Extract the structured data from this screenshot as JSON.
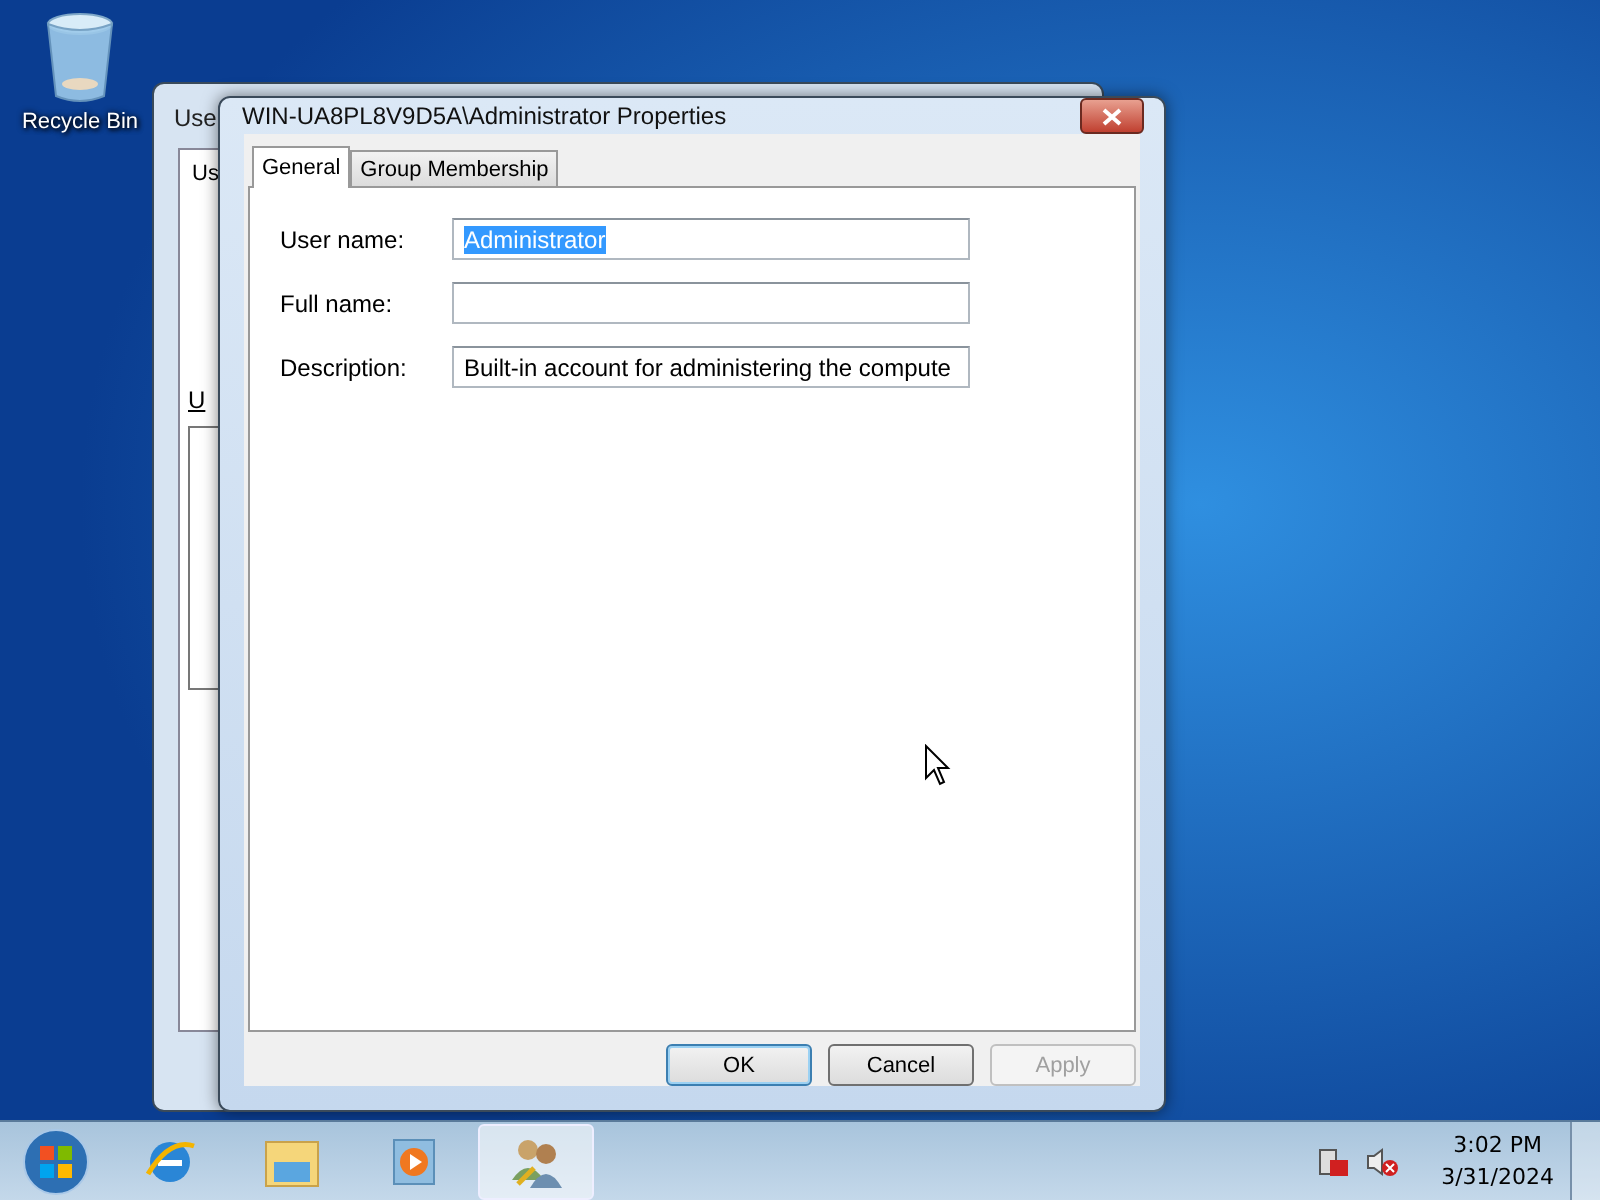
{
  "desktop_icons": [
    {
      "label": "Recycle Bin"
    }
  ],
  "back_window": {
    "title": "Use",
    "tab": "Us",
    "label": "U"
  },
  "dialog": {
    "title": "WIN-UA8PL8V9D5A\\Administrator Properties",
    "tabs": [
      {
        "label": "General",
        "selected": true
      },
      {
        "label": "Group Membership",
        "selected": false
      }
    ],
    "fields": [
      {
        "label": "User name:",
        "value": "Administrator",
        "text_selected": true
      },
      {
        "label": "Full name:"
      },
      {
        "label": "Description:",
        "value": "Built-in account for administering the compute"
      }
    ],
    "buttons": [
      {
        "label": "OK",
        "default": true,
        "disabled": false
      },
      {
        "label": "Cancel",
        "default": false,
        "disabled": false
      },
      {
        "label": "Apply",
        "default": false,
        "disabled": true
      }
    ]
  },
  "taskbar": {
    "apps": [
      {
        "kind": "ie",
        "active": false
      },
      {
        "kind": "explorer",
        "active": false
      },
      {
        "kind": "media",
        "active": false
      },
      {
        "kind": "users",
        "active": true
      }
    ],
    "time": "3:02 PM",
    "date": "3/31/2024"
  }
}
